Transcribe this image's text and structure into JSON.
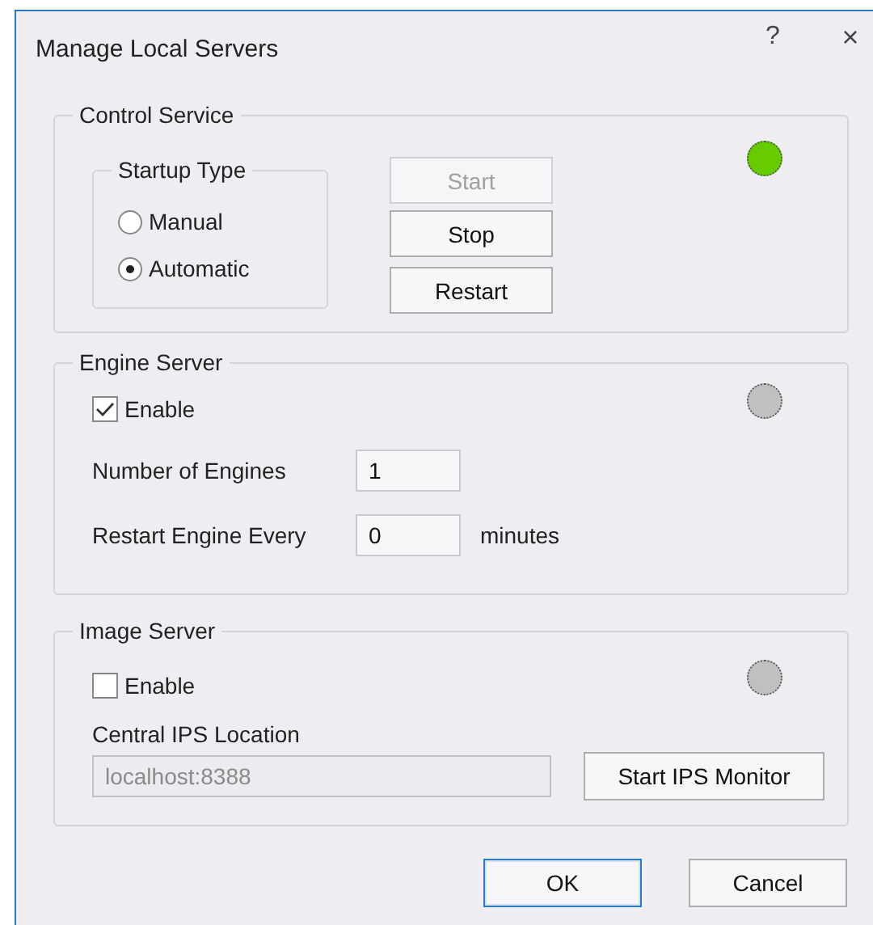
{
  "window": {
    "title": "Manage Local Servers",
    "help": "?",
    "close": "×"
  },
  "control_service": {
    "title": "Control Service",
    "status_light": {
      "color": "#66cc00"
    },
    "startup_type": {
      "title": "Startup Type",
      "options": [
        {
          "label": "Manual",
          "selected": false
        },
        {
          "label": "Automatic",
          "selected": true
        }
      ]
    },
    "buttons": [
      {
        "label": "Start",
        "disabled": true
      },
      {
        "label": "Stop",
        "disabled": false
      },
      {
        "label": "Restart",
        "disabled": false
      }
    ]
  },
  "engine_server": {
    "title": "Engine Server",
    "status_light": {
      "color": "#c0c0c0"
    },
    "enable": {
      "label": "Enable",
      "checked": true
    },
    "fields": [
      {
        "label": "Number of Engines",
        "value": "1"
      },
      {
        "label": "Restart Engine Every",
        "value": "0",
        "unit": "minutes"
      }
    ]
  },
  "image_server": {
    "title": "Image Server",
    "status_light": {
      "color": "#c0c0c0"
    },
    "enable": {
      "label": "Enable",
      "checked": false
    },
    "location": {
      "label": "Central IPS Location",
      "value": "localhost:8388",
      "disabled": true
    },
    "monitor_button": {
      "label": "Start IPS Monitor"
    }
  },
  "buttons": [
    {
      "label": "OK",
      "default": true
    },
    {
      "label": "Cancel",
      "default": false
    }
  ]
}
